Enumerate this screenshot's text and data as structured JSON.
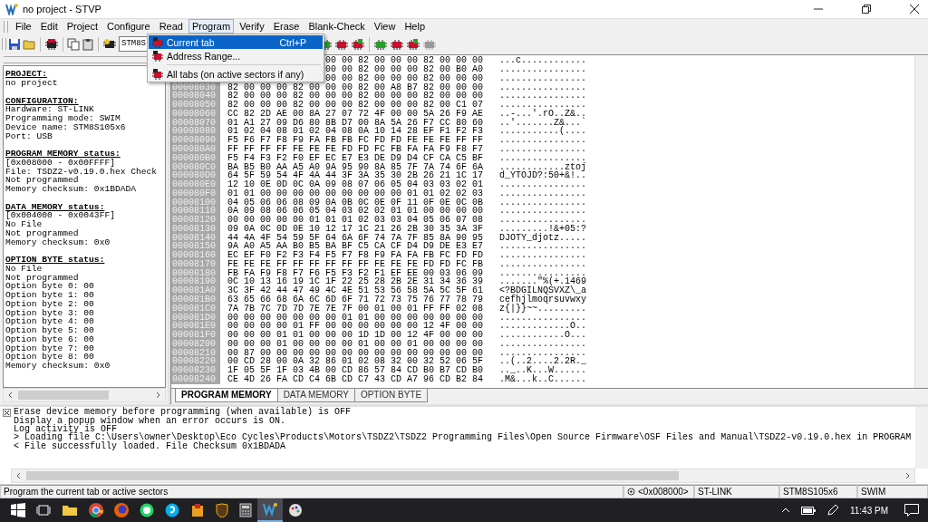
{
  "window": {
    "title": "no project - STVP"
  },
  "menu": [
    {
      "label": "File",
      "selected": false
    },
    {
      "label": "Edit",
      "selected": false
    },
    {
      "label": "Project",
      "selected": false
    },
    {
      "label": "Configure",
      "selected": false
    },
    {
      "label": "Read",
      "selected": false
    },
    {
      "label": "Program",
      "selected": true
    },
    {
      "label": "Verify",
      "selected": false
    },
    {
      "label": "Erase",
      "selected": false
    },
    {
      "label": "Blank-Check",
      "selected": false
    },
    {
      "label": "View",
      "selected": false
    },
    {
      "label": "Help",
      "selected": false
    }
  ],
  "program_menu": [
    {
      "label": "Current tab",
      "shortcut": "Ctrl+P",
      "selected": true,
      "separator_before": false
    },
    {
      "label": "Address Range...",
      "selected": false,
      "separator_before": false
    },
    {
      "label": "All tabs (on active sectors if any)",
      "selected": false,
      "separator_before": true
    }
  ],
  "toolbar": {
    "device": "STM8S"
  },
  "info_panel": [
    {
      "heading": "PROJECT:",
      "lines": [
        "no project"
      ]
    },
    {
      "heading": "CONFIGURATION:",
      "lines": [
        "Hardware: ST-LINK",
        "Programming mode: SWIM",
        "Device name: STM8S105x6",
        "Port: USB"
      ]
    },
    {
      "heading": "PROGRAM MEMORY status:",
      "lines": [
        "[0x008000 - 0x00FFFF]",
        "File: TSDZ2-v0.19.0.hex Check",
        "Not programmed",
        "Memory checksum: 0x1BDADA"
      ]
    },
    {
      "heading": "DATA MEMORY status:",
      "lines": [
        "[0x004000 - 0x0043FF]",
        "No File",
        "Not programmed",
        "Memory checksum: 0x0"
      ]
    },
    {
      "heading": "OPTION BYTE status:",
      "lines": [
        "No File",
        "Not programmed",
        "Option byte 0: 00",
        "Option byte 1: 00",
        "Option byte 2: 00",
        "Option byte 3: 00",
        "Option byte 4: 00",
        "Option byte 5: 00",
        "Option byte 6: 00",
        "Option byte 7: 00",
        "Option byte 8: 00",
        "Memory checksum: 0x0"
      ]
    }
  ],
  "memory_view": {
    "rows": [
      {
        "bytes": "00 00 82 00 00 00 82 00 00 00",
        "ascii": "...c............"
      },
      {
        "bytes": "00 00 82 00 00 00 82 00 B0 A0",
        "ascii": "................"
      },
      {
        "bytes": "00 00 82 00 00 00 82 00 00 00",
        "ascii": "................"
      },
      {
        "address": "00008030",
        "bytes": "82 00 00 00 82 00 00 00 82 00 A8 B7 82 00 00 00",
        "ascii": "................"
      },
      {
        "address": "00008040",
        "bytes": "82 00 00 00 82 00 00 00 82 00 00 00 82 00 00 00",
        "ascii": "................"
      },
      {
        "address": "00008050",
        "bytes": "82 00 00 00 82 00 00 00 82 00 00 00 82 00 C1 07",
        "ascii": "................"
      },
      {
        "address": "00008060",
        "bytes": "CC 82 2D AE 00 8A 27 07 72 4F 00 00 5A 26 F9 AE",
        "ascii": "..-...'.rO..Z&.."
      },
      {
        "address": "00008070",
        "bytes": "01 A1 27 09 D6 80 8B D7 00 8A 5A 26 F7 CC 80 60",
        "ascii": "..'.......Z&...`"
      },
      {
        "address": "00008080",
        "bytes": "01 02 04 08 01 02 04 08 0A 10 14 28 EF F1 F2 F3",
        "ascii": "...........(...."
      },
      {
        "address": "00008090",
        "bytes": "F5 F6 F7 F8 F9 FA FB FB FC FD FD FE FE FE FF FF",
        "ascii": "................"
      },
      {
        "address": "000080A0",
        "bytes": "FF FF FF FF FE FE FE FD FD FC FB FA FA F9 F8 F7",
        "ascii": "................"
      },
      {
        "address": "000080B0",
        "bytes": "F5 F4 F3 F2 F0 EF EC E7 E3 DE D9 D4 CF CA C5 BF",
        "ascii": "................"
      },
      {
        "address": "000080C0",
        "bytes": "BA B5 B0 AA A5 A0 9A 95 90 8A 85 7F 7A 74 6F 6A",
        "ascii": "............ztoj"
      },
      {
        "address": "000080D0",
        "bytes": "64 5F 59 54 4F 4A 44 3F 3A 35 30 2B 26 21 1C 17",
        "ascii": "d_YTOJD?:50+&!.."
      },
      {
        "address": "000080E0",
        "bytes": "12 10 0E 0D 0C 0A 09 08 07 06 05 04 03 03 02 01",
        "ascii": "................"
      },
      {
        "address": "000080F0",
        "bytes": "01 01 00 00 00 00 00 00 00 00 00 01 01 02 02 03",
        "ascii": "................"
      },
      {
        "address": "00008100",
        "bytes": "04 05 06 06 08 09 0A 0B 0C 0E 0F 11 0F 0E 0C 0B",
        "ascii": "................"
      },
      {
        "address": "00008110",
        "bytes": "0A 09 08 06 06 05 04 03 02 02 01 01 00 00 00 00",
        "ascii": "................"
      },
      {
        "address": "00008120",
        "bytes": "00 00 00 00 00 01 01 01 02 03 03 04 05 06 07 08",
        "ascii": "................"
      },
      {
        "address": "00008130",
        "bytes": "09 0A 0C 0D 0E 10 12 17 1C 21 26 2B 30 35 3A 3F",
        "ascii": ".........!&+05:?"
      },
      {
        "address": "00008140",
        "bytes": "44 4A 4F 54 59 5F 64 6A 6F 74 7A 7F 85 8A 90 95",
        "ascii": "DJOTY_djotz....."
      },
      {
        "address": "00008150",
        "bytes": "9A A0 A5 AA B0 B5 BA BF C5 CA CF D4 D9 DE E3 E7",
        "ascii": "................"
      },
      {
        "address": "00008160",
        "bytes": "EC EF F0 F2 F3 F4 F5 F7 F8 F9 FA FA FB FC FD FD",
        "ascii": "................"
      },
      {
        "address": "00008170",
        "bytes": "FE FE FE FF FF FF FF FF FF FE FE FE FD FD FC FB",
        "ascii": "................"
      },
      {
        "address": "00008180",
        "bytes": "FB FA F9 F8 F7 F6 F5 F3 F2 F1 EF EE 00 03 06 09",
        "ascii": "................"
      },
      {
        "address": "00008190",
        "bytes": "0C 10 13 16 19 1C 1F 22 25 28 2B 2E 31 34 36 39",
        "ascii": ".......\"%(+.1469"
      },
      {
        "address": "000081A0",
        "bytes": "3C 3F 42 44 47 49 4C 4E 51 53 56 58 5A 5C 5F 61",
        "ascii": "<?BDGILNQSVXZ\\_a"
      },
      {
        "address": "000081B0",
        "bytes": "63 65 66 68 6A 6C 6D 6F 71 72 73 75 76 77 78 79",
        "ascii": "cefhjlmoqrsuvwxy"
      },
      {
        "address": "000081C0",
        "bytes": "7A 7B 7C 7D 7D 7E 7E 7F 00 01 00 01 FF FF 02 08",
        "ascii": "z{|}}~~........."
      },
      {
        "address": "000081D0",
        "bytes": "00 00 00 00 00 00 00 01 01 00 00 00 00 00 00 00",
        "ascii": "................"
      },
      {
        "address": "000081E0",
        "bytes": "00 00 00 00 01 FF 00 00 00 00 00 00 12 4F 00 00",
        "ascii": ".............O.."
      },
      {
        "address": "000081F0",
        "bytes": "00 00 00 01 01 00 00 00 1D 1D 00 12 4F 00 00 00",
        "ascii": "............O..."
      },
      {
        "address": "00008200",
        "bytes": "00 00 00 01 00 00 00 00 01 00 00 01 00 00 00 00",
        "ascii": "................"
      },
      {
        "address": "00008210",
        "bytes": "00 87 00 00 00 00 00 00 00 00 00 00 00 00 00 00",
        "ascii": "................"
      },
      {
        "address": "00008220",
        "bytes": "00 CD 28 00 0A 32 86 01 02 08 32 00 32 52 06 5F",
        "ascii": "..(..2....2.2R._"
      },
      {
        "address": "00008230",
        "bytes": "1F 05 5F 1F 03 4B 00 CD 86 57 84 CD B0 B7 CD B0",
        "ascii": ".._..K...W......"
      },
      {
        "address": "00008240",
        "bytes": "CE 4D 26 FA CD C4 6B CD C7 43 CD A7 96 CD B2 84",
        "ascii": ".M&...k..C......"
      }
    ]
  },
  "tabs": [
    {
      "label": "PROGRAM MEMORY",
      "selected": true
    },
    {
      "label": "DATA MEMORY",
      "selected": false
    },
    {
      "label": "OPTION BYTE",
      "selected": false
    }
  ],
  "log": [
    "Erase device memory before programming (when available) is OFF",
    "Display a popup window when an error occurs is ON.",
    "Log activity is OFF",
    "> Loading file C:\\Users\\owner\\Desktop\\Eco Cycles\\Products\\Motors\\TSDZ2\\TSDZ2 Programming Files\\Open Source Firmware\\OSF Files and Manual\\TSDZ2-v0.19.0.hex in PROGRAM",
    "< File successfully loaded. File Checksum 0x1BDADA"
  ],
  "status_bar": {
    "message": "Program the current tab or active sectors",
    "address": "<0x008000>",
    "hardware": "ST-LINK",
    "device": "STM8S105x6",
    "mode": "SWIM"
  },
  "taskbar": {
    "time": "11:43 PM"
  }
}
